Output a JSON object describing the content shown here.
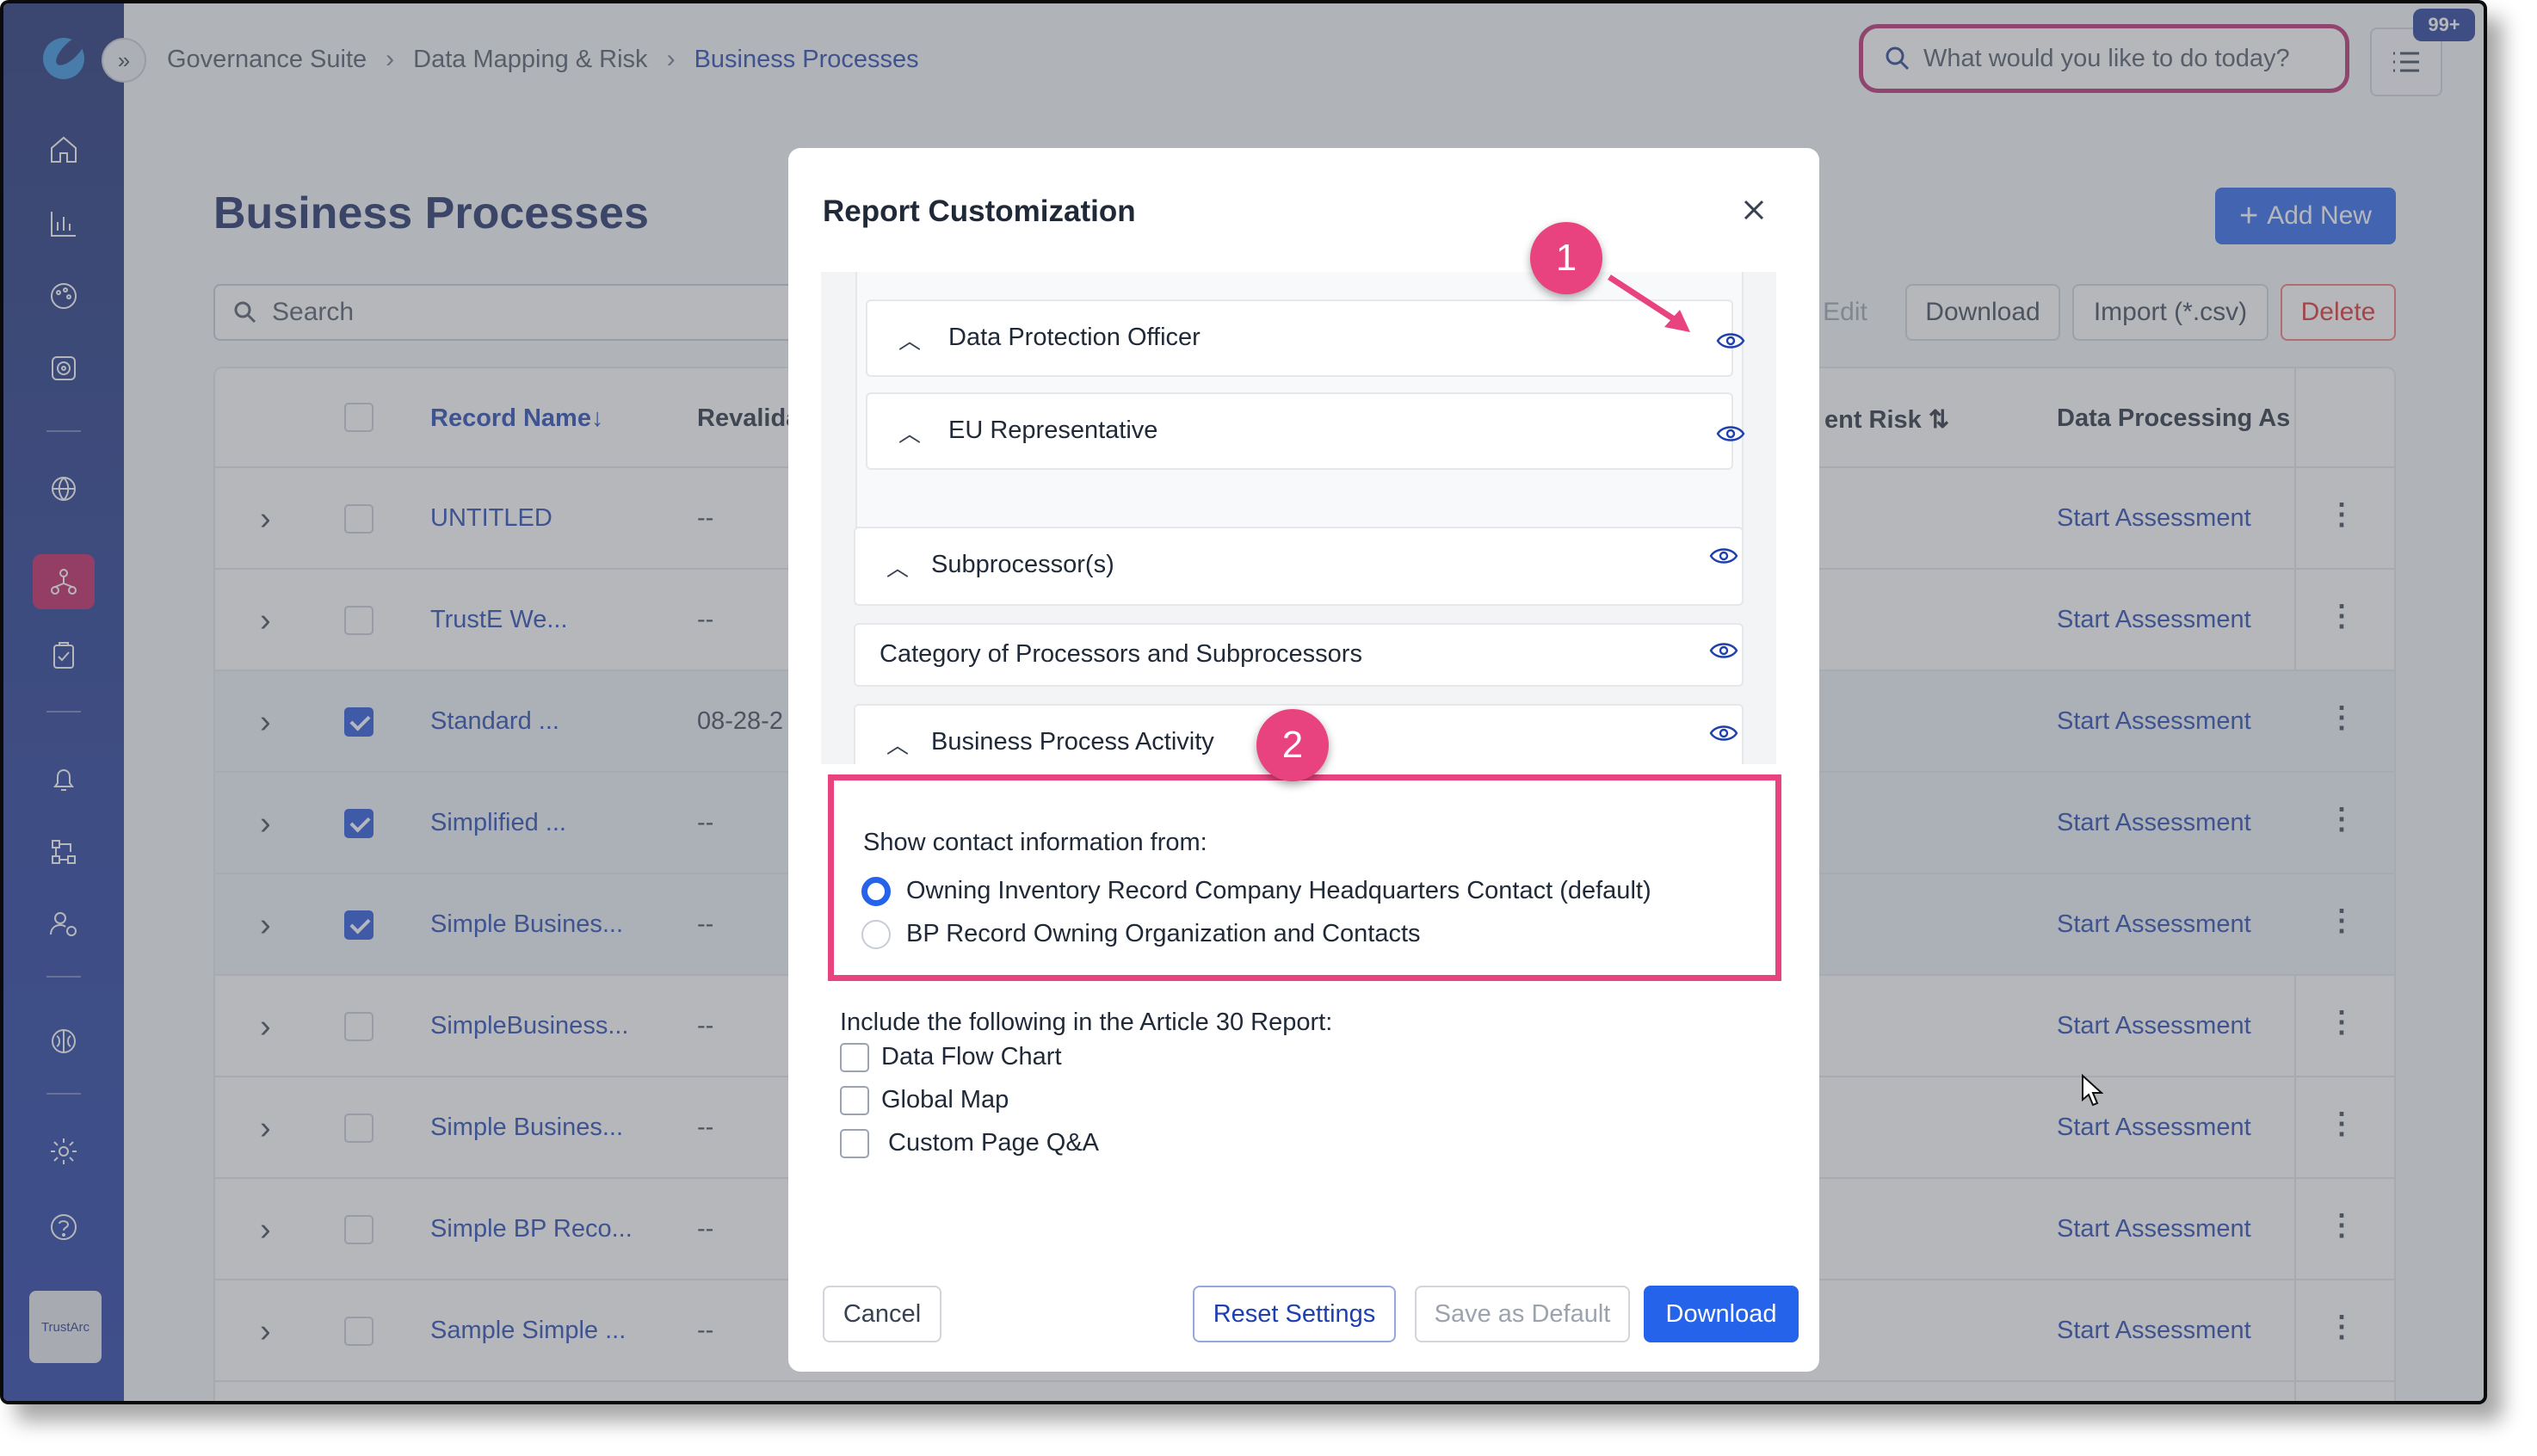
{
  "header": {
    "breadcrumb": [
      "Governance Suite",
      "Data Mapping & Risk",
      "Business Processes"
    ],
    "search_placeholder": "What would you like to do today?",
    "notification_badge": "99+"
  },
  "sidebar": {
    "icons": [
      "home-icon",
      "bar-chart-icon",
      "palette-icon",
      "target-icon",
      "globe-icon",
      "network-icon",
      "clipboard-check-icon",
      "bell-icon",
      "flow-icon",
      "user-gear-icon",
      "brain-icon",
      "gear-icon",
      "help-icon"
    ],
    "active": "network-icon",
    "brand": "TrustArc"
  },
  "page": {
    "title": "Business Processes",
    "add_new": "Add New",
    "search_placeholder": "Search",
    "actions": {
      "edit": "Edit",
      "download": "Download",
      "import": "Import (*.csv)",
      "delete": "Delete"
    }
  },
  "table": {
    "columns": {
      "name": "Record Name",
      "revalidation": "Revalida",
      "risk": "ent Risk",
      "dpa": "Data Processing Ass"
    },
    "rows": [
      {
        "name": "UNTITLED",
        "reval": "--",
        "assess": "Start Assessment",
        "checked": false
      },
      {
        "name": "TrustE We...",
        "reval": "--",
        "assess": "Start Assessment",
        "checked": false
      },
      {
        "name": "Standard ...",
        "reval": "08-28-2",
        "assess": "Start Assessment",
        "checked": true
      },
      {
        "name": "Simplified ...",
        "reval": "--",
        "assess": "Start Assessment",
        "checked": true
      },
      {
        "name": "Simple Busines...",
        "reval": "--",
        "assess": "Start Assessment",
        "checked": true
      },
      {
        "name": "SimpleBusiness...",
        "reval": "--",
        "assess": "Start Assessment",
        "checked": false
      },
      {
        "name": "Simple Busines...",
        "reval": "--",
        "assess": "Start Assessment",
        "checked": false
      },
      {
        "name": "Simple BP Reco...",
        "reval": "--",
        "assess": "Start Assessment",
        "checked": false
      },
      {
        "name": "Sample Simple ...",
        "reval": "--",
        "assess": "Start Assessment",
        "checked": false
      }
    ]
  },
  "modal": {
    "title": "Report Customization",
    "sections": {
      "dpo": "Data Protection Officer",
      "eu_rep": "EU Representative",
      "subprocessors": "Subprocessor(s)",
      "category": "Category of Processors and Subprocessors",
      "bpa": "Business Process Activity"
    },
    "contact_question": "Show contact information from:",
    "contact_options": [
      {
        "label": "Owning Inventory Record Company Headquarters Contact (default)",
        "selected": true
      },
      {
        "label": "BP Record Owning Organization and Contacts",
        "selected": false
      }
    ],
    "include_question": "Include the following in the Article 30 Report:",
    "include_options": [
      "Data Flow Chart",
      "Global Map",
      "Custom Page Q&A"
    ],
    "buttons": {
      "cancel": "Cancel",
      "reset": "Reset Settings",
      "save_default": "Save as Default",
      "download": "Download"
    }
  },
  "annotations": {
    "marker1": "1",
    "marker2": "2",
    "accent": "#e8437e"
  }
}
